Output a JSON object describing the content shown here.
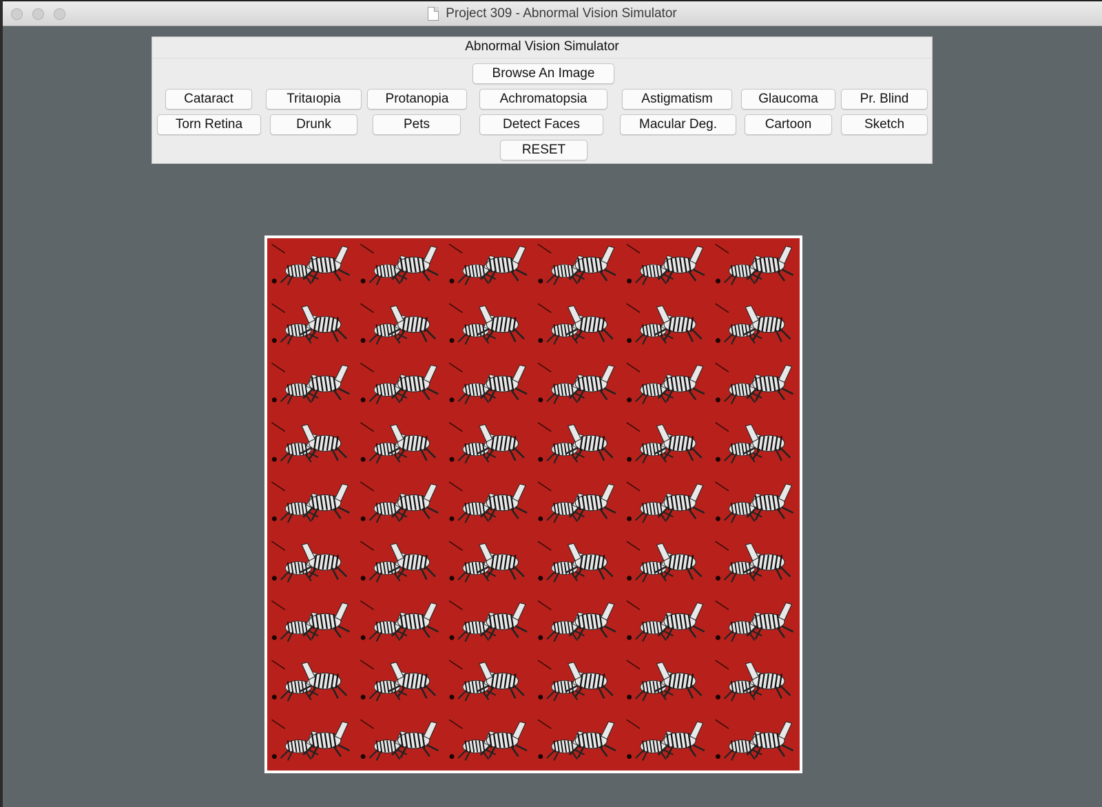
{
  "window": {
    "title": "Project 309 - Abnormal Vision Simulator"
  },
  "panel": {
    "title": "Abnormal Vision Simulator",
    "browse_label": "Browse An Image",
    "reset_label": "RESET",
    "row1": [
      "Cataract",
      "Tritaıopia",
      "Protanopia",
      "Achromatopsia",
      "Astigmatism",
      "Glaucoma",
      "Pr. Blind"
    ],
    "row2": [
      "Torn Retina",
      "Drunk",
      "Pets",
      "Detect Faces",
      "Macular Deg.",
      "Cartoon",
      "Sketch"
    ]
  },
  "image": {
    "description_icon": "zebra-pattern-image",
    "background_color": "#b8211b",
    "pattern_rows": 9,
    "pattern_cols": 6
  },
  "colors": {
    "window_bg": "#5f6669",
    "panel_bg": "#ececec"
  }
}
